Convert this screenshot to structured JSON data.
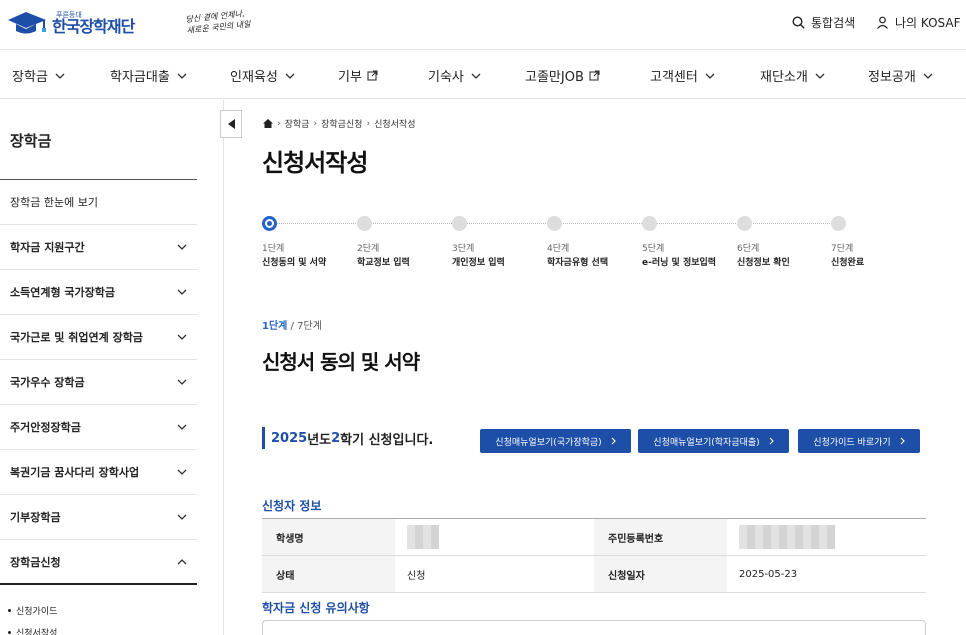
{
  "header": {
    "logo_sub": "푸른등대",
    "logo_main": "한국장학재단",
    "slogan_line1": "당신 곁에 언제나,",
    "slogan_line2": "새로운 국민의 내일",
    "search_label": "통합검색",
    "my_label": "나의 KOSAF"
  },
  "gnb": [
    {
      "label": "장학금",
      "icon": "chevron-down-icon"
    },
    {
      "label": "학자금대출",
      "icon": "chevron-down-icon"
    },
    {
      "label": "인재육성",
      "icon": "chevron-down-icon"
    },
    {
      "label": "기부",
      "icon": "external-link-icon"
    },
    {
      "label": "기숙사",
      "icon": "chevron-down-icon"
    },
    {
      "label": "고졸만JOB",
      "icon": "external-link-icon"
    },
    {
      "label": "고객센터",
      "icon": "chevron-down-icon"
    },
    {
      "label": "재단소개",
      "icon": "chevron-down-icon"
    },
    {
      "label": "정보공개",
      "icon": "chevron-down-icon"
    }
  ],
  "sidebar": {
    "title": "장학금",
    "items": [
      {
        "label": "장학금 한눈에 보기"
      },
      {
        "label": "학자금 지원구간"
      },
      {
        "label": "소득연계형 국가장학금"
      },
      {
        "label": "국가근로 및 취업연계 장학금"
      },
      {
        "label": "국가우수 장학금"
      },
      {
        "label": "주거안정장학금"
      },
      {
        "label": "복권기금 꿈사다리 장학사업"
      },
      {
        "label": "기부장학금"
      },
      {
        "label": "장학금신청"
      }
    ],
    "subitems": [
      {
        "label": "신청가이드"
      },
      {
        "label": "신청서작성"
      }
    ]
  },
  "breadcrumb": [
    "장학금",
    "장학금신청",
    "신청서작성"
  ],
  "page_title": "신청서작성",
  "steps": [
    {
      "num": "1단계",
      "name": "신청동의 및 서약"
    },
    {
      "num": "2단계",
      "name": "학교정보 입력"
    },
    {
      "num": "3단계",
      "name": "개인정보 입력"
    },
    {
      "num": "4단계",
      "name": "학자금유형 선택"
    },
    {
      "num": "5단계",
      "name": "e-러닝 및 정보입력"
    },
    {
      "num": "6단계",
      "name": "신청정보 확인"
    },
    {
      "num": "7단계",
      "name": "신청완료"
    }
  ],
  "current_step": {
    "current": "1단계",
    "total": " / 7단계"
  },
  "section_title": "신청서 동의 및 서약",
  "semester": {
    "year": "2025",
    "year_suffix": "년도 ",
    "term": "2",
    "term_suffix": "학기 신청입니다."
  },
  "buttons": [
    {
      "label": "신청매뉴얼보기(국가장학금)"
    },
    {
      "label": "신청매뉴얼보기(학자금대출)"
    },
    {
      "label": "신청가이드 바로가기"
    }
  ],
  "applicant": {
    "title": "신청자 정보",
    "name_label": "학생명",
    "id_label": "주민등록번호",
    "status_label": "상태",
    "status_value": "신청",
    "date_label": "신청일자",
    "date_value": "2025-05-23"
  },
  "notice_title": "학자금 신청 유의사항",
  "colors": {
    "primary": "#1e4fa8",
    "accent": "#2563c7"
  }
}
